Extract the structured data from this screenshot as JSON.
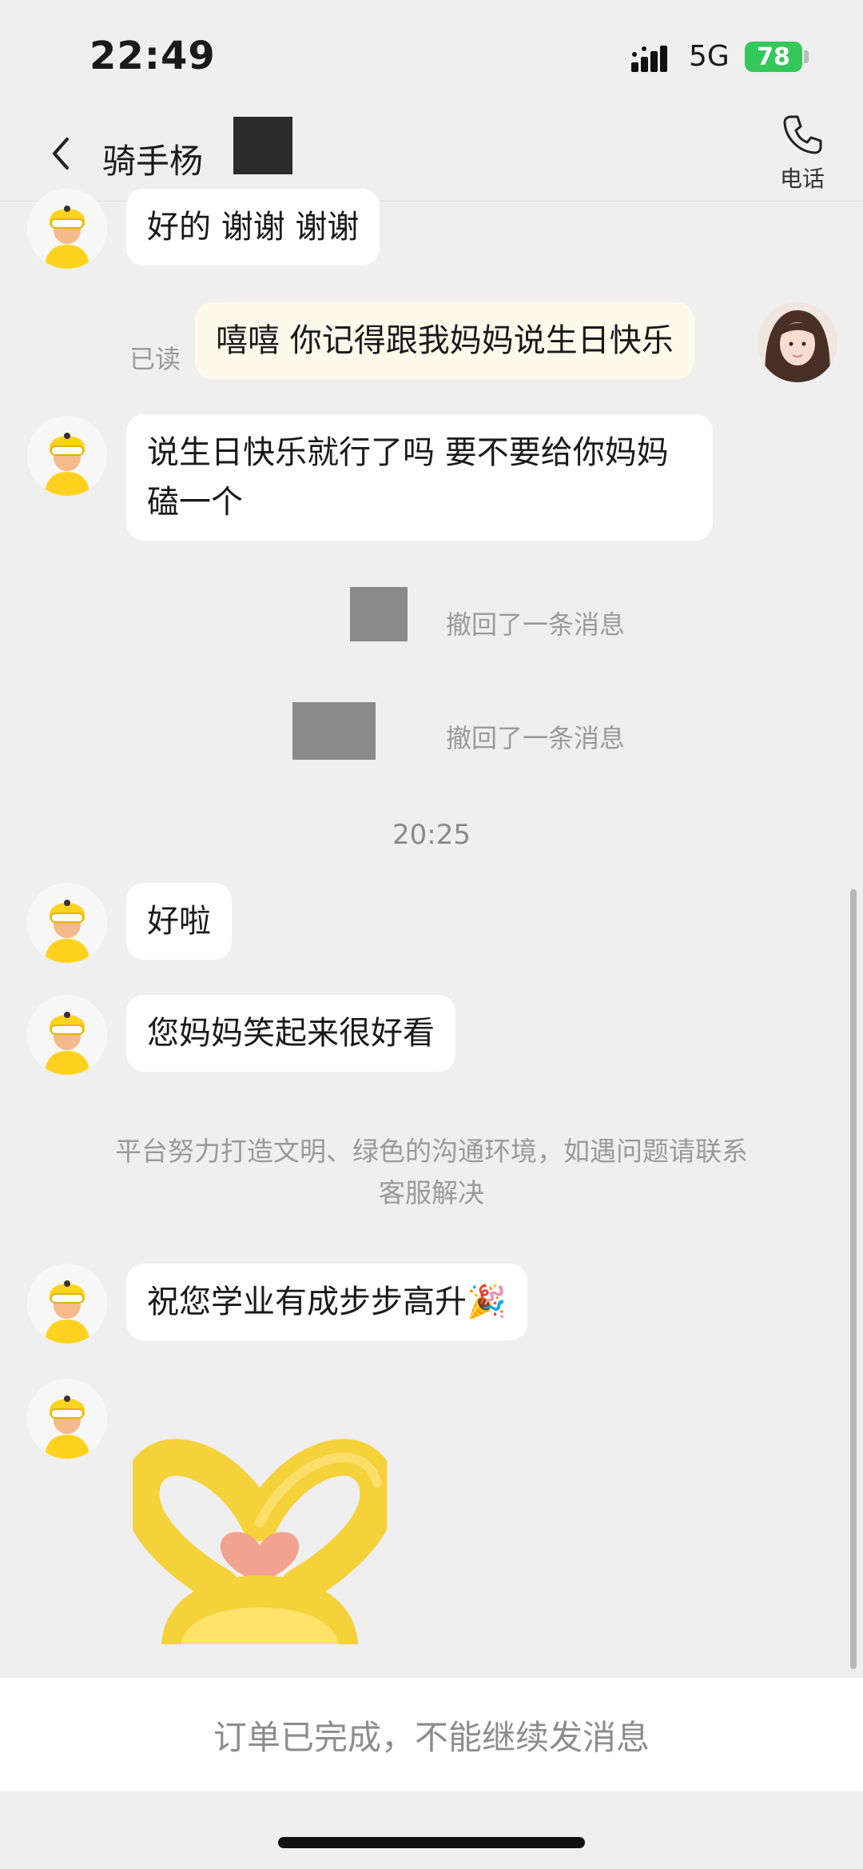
{
  "status_bar": {
    "time": "22:49",
    "network": "5G",
    "battery": "78"
  },
  "header": {
    "title": "骑手杨",
    "call_label": "电话"
  },
  "messages": [
    {
      "text": "好的 谢谢 谢谢"
    },
    {
      "text": "嘻嘻 你记得跟我妈妈说生日快乐",
      "read": "已读"
    },
    {
      "text": "说生日快乐就行了吗 要不要给你妈妈磕一个"
    },
    {
      "text": "好啦"
    },
    {
      "text": "您妈妈笑起来很好看"
    },
    {
      "text": "祝您学业有成步步高升🎉"
    }
  ],
  "system": {
    "recall_1": "撤回了一条消息",
    "recall_2": "撤回了一条消息",
    "time": "20:25",
    "notice": "平台努力打造文明、绿色的沟通环境，如遇问题请联系客服解决"
  },
  "footer": {
    "text": "订单已完成，不能继续发消息"
  },
  "icons": {
    "back": "chevron-left-icon",
    "call": "phone-icon",
    "rider_avatar": "rider-avatar",
    "sticker": "heart-sticker"
  }
}
